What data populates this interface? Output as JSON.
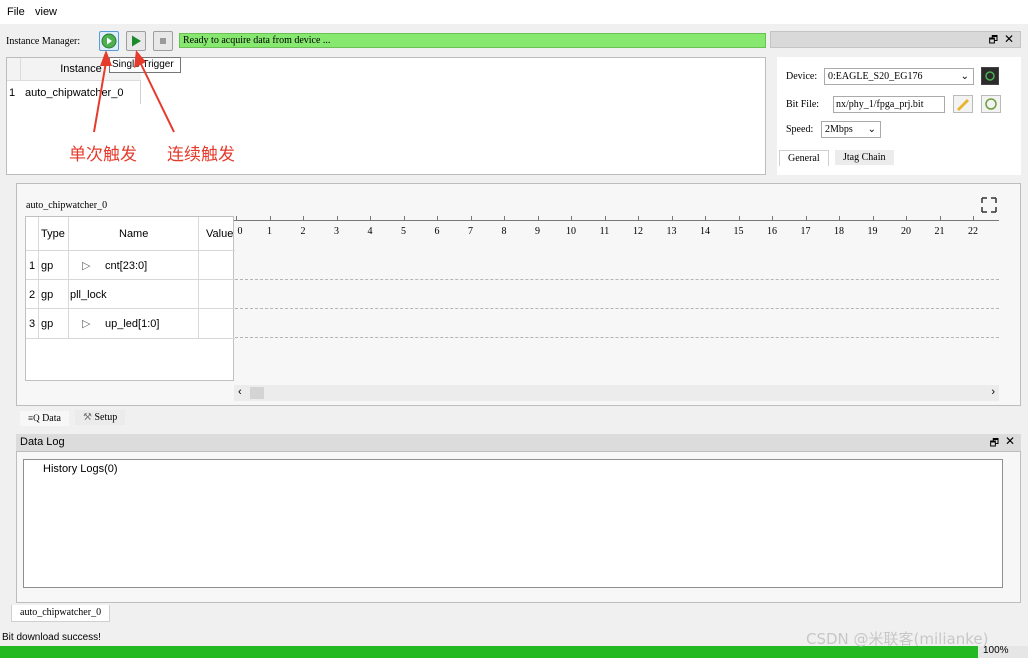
{
  "menu": {
    "file": "File",
    "view": "view"
  },
  "toolbar": {
    "instance_manager_label": "Instance Manager:",
    "status_text": "Ready to acquire data from device ...",
    "tooltip": "Single Trigger"
  },
  "instance_table": {
    "header": "Instance",
    "row_index": "1",
    "row_value": "auto_chipwatcher_0"
  },
  "annotations": {
    "single_trigger": "单次触发",
    "continuous_trigger": "连续触发"
  },
  "device_panel": {
    "device_label": "Device:",
    "device_value": "0:EAGLE_S20_EG176",
    "bitfile_label": "Bit File:",
    "bitfile_value": "nx/phy_1/fpga_prj.bit",
    "speed_label": "Speed:",
    "speed_value": "2Mbps",
    "tabs": [
      "General",
      "Jtag Chain"
    ]
  },
  "wave_panel": {
    "title": "auto_chipwatcher_0",
    "columns": [
      "Type",
      "Name",
      "Value"
    ],
    "rows": [
      {
        "idx": "1",
        "type": "gp",
        "name": "cnt[23:0]",
        "expand": "▷"
      },
      {
        "idx": "2",
        "type": "gp",
        "name": "pll_lock",
        "expand": ""
      },
      {
        "idx": "3",
        "type": "gp",
        "name": "up_led[1:0]",
        "expand": "▷"
      }
    ],
    "ticks": [
      "0",
      "1",
      "2",
      "3",
      "4",
      "5",
      "6",
      "7",
      "8",
      "9",
      "10",
      "11",
      "12",
      "13",
      "14",
      "15",
      "16",
      "17",
      "18",
      "19",
      "20",
      "21",
      "22"
    ],
    "tabs": [
      "Data",
      "Setup"
    ]
  },
  "data_log": {
    "title": "Data Log",
    "history": "History Logs(0)"
  },
  "bottom_tab": "auto_chipwatcher_0",
  "status_bar": {
    "message": "Bit download success!",
    "progress_percent": 100,
    "progress_text": "100%",
    "watermark": "CSDN @米联客(milianke)"
  },
  "colors": {
    "status_green": "#86e86f",
    "progress_green": "#22b922",
    "annotation_red": "#e53b2c"
  }
}
